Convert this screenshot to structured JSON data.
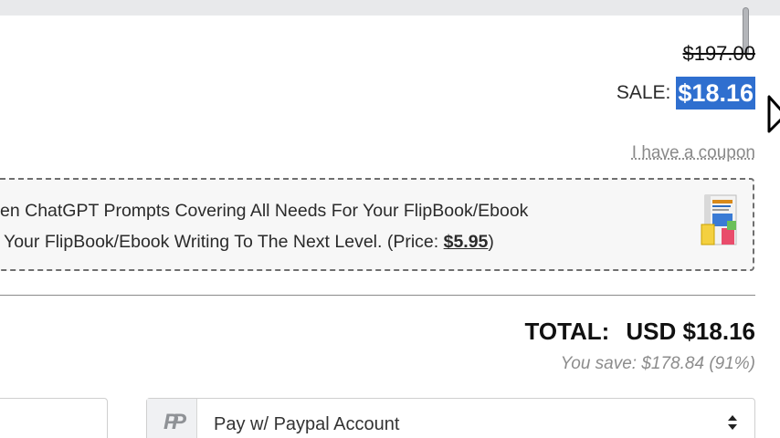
{
  "pricing": {
    "old_price": "$197.00",
    "sale_label": "SALE:",
    "sale_price": "$18.16"
  },
  "coupon": {
    "link_text": "I have a coupon"
  },
  "order_bump": {
    "line1": "en ChatGPT Prompts Covering All Needs For Your FlipBook/Ebook",
    "line2_prefix": "Your FlipBook/Ebook Writing To The Next Level. (Price: ",
    "price": "$5.95",
    "line2_suffix": ")",
    "thumbnail_icon": "ebook-cover-icon"
  },
  "totals": {
    "label": "TOTAL:",
    "amount": "USD $18.16",
    "savings": "You save: $178.84 (91%)"
  },
  "payment": {
    "method_icon": "paypal-icon",
    "selected_option": "Pay w/ Paypal Account"
  },
  "colors": {
    "selection_highlight": "#2f6fcf",
    "muted_text": "#8c8c8c"
  }
}
